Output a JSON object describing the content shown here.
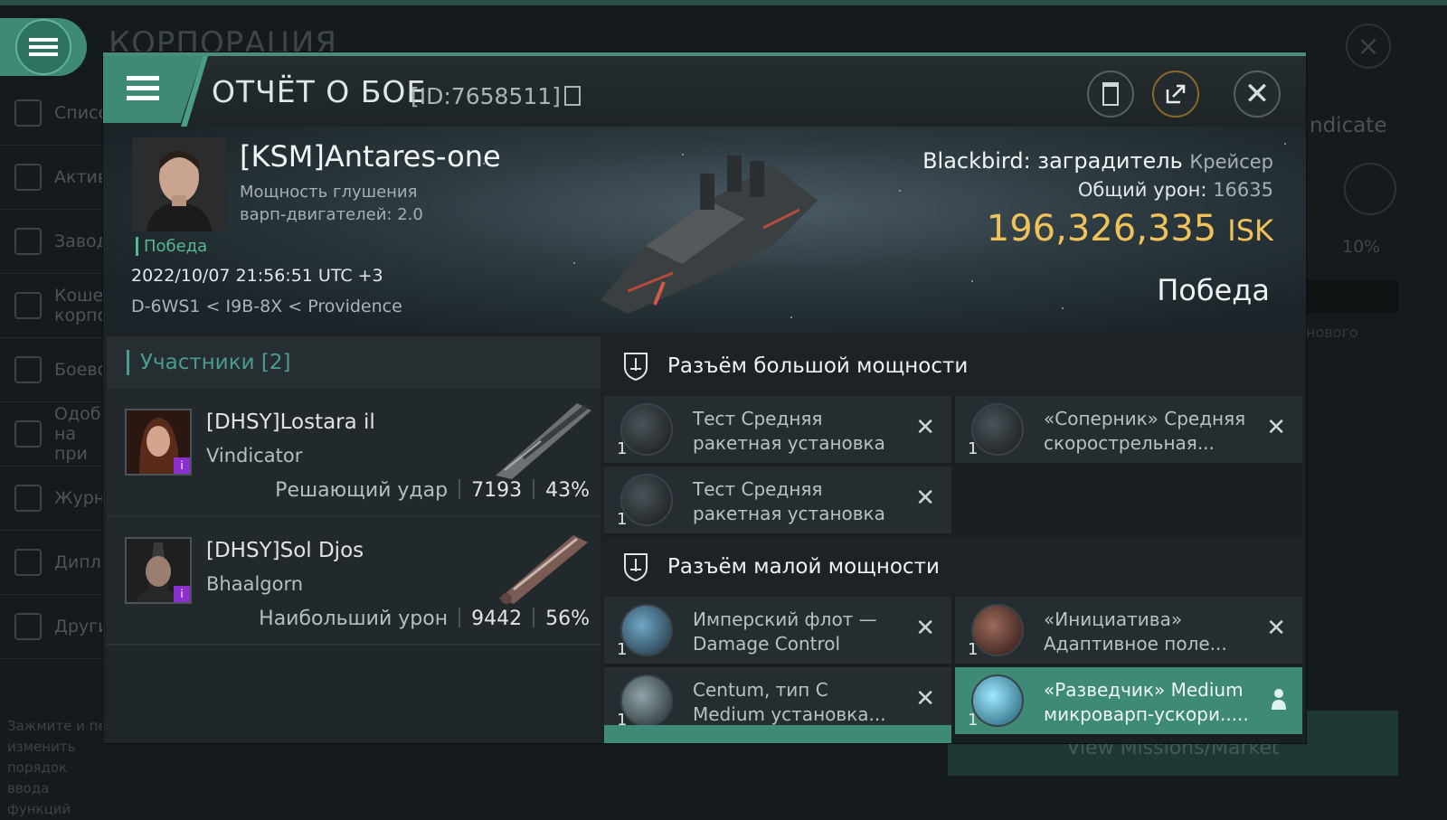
{
  "background": {
    "title": "КОРПОРАЦИЯ",
    "sidebar": [
      "Списо",
      "Актив",
      "Завод",
      "Кошел корпо",
      "Боево",
      "Одобр на при",
      "Журна",
      "Дипло",
      "Други"
    ],
    "hint": "Зажмите и пе изменить порядок ввода функций",
    "right_text": "ndicate",
    "right_pct": "10%",
    "right_new": "нового",
    "bottom_button": "View Missions/Market"
  },
  "header": {
    "title": "ОТЧЁТ О БОЕ",
    "id": "[ID:7658511]"
  },
  "victim": {
    "pilot": "[KSM]Antares-one",
    "attr_line1": "Мощность глушения",
    "attr_line2": "варп-двигателей: 2.0",
    "status": "Победа",
    "datetime": "2022/10/07 21:56:51 UTC +3",
    "location": "D-6WS1 < I9B-8X < Providence",
    "ship": "Blackbird: заградитель",
    "ship_class": "Крейсер",
    "damage_label": "Общий урон:",
    "damage_value": "16635",
    "isk_value": "196,326,335",
    "isk_unit": "ISK",
    "result": "Победа"
  },
  "participants": {
    "label": "Участники [2]",
    "items": [
      {
        "name": "[DHSY]Lostara il",
        "ship": "Vindicator",
        "role": "Решающий удар",
        "damage": "7193",
        "percent": "43%"
      },
      {
        "name": "[DHSY]Sol Djos",
        "ship": "Bhaalgorn",
        "role": "Наибольший урон",
        "damage": "9442",
        "percent": "56%"
      }
    ]
  },
  "fitting": {
    "high_label": "Разъём большой мощности",
    "high": [
      {
        "qty": "1",
        "line1": "Тест Средняя",
        "line2": "ракетная установка"
      },
      {
        "qty": "1",
        "line1": "«Соперник» Средняя",
        "line2": "скорострельная..."
      },
      {
        "qty": "1",
        "line1": "Тест Средняя",
        "line2": "ракетная установка"
      }
    ],
    "low_label": "Разъём малой мощности",
    "low": [
      {
        "qty": "1",
        "line1": "Имперский флот —",
        "line2": "Damage Control"
      },
      {
        "qty": "1",
        "line1": "«Инициатива»",
        "line2": "Адаптивное поле..."
      },
      {
        "qty": "1",
        "line1": "Centum, тип C",
        "line2": "Medium установка..."
      },
      {
        "qty": "1",
        "line1": "«Разведчик» Medium",
        "line2": "микроварп-ускори....."
      }
    ]
  }
}
